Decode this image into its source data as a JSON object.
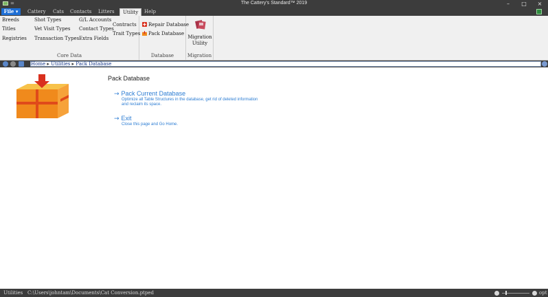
{
  "window": {
    "title": "The Cattery's Standard™ 2019",
    "quick_access": "=",
    "minimize": "–",
    "maximize": "□",
    "close": "×"
  },
  "menu": {
    "file": "File ▾",
    "tabs": [
      "Cattery",
      "Cats",
      "Contacts",
      "Litters",
      "Utility",
      "Help"
    ],
    "active_tab": "Utility"
  },
  "ribbon": {
    "core_data": {
      "caption": "Core Data",
      "col1": [
        "Breeds",
        "Titles",
        "Registries"
      ],
      "col2": [
        "Shot Types",
        "Vet Visit Types",
        "Transaction Types"
      ],
      "col3": [
        "G/L Accounts",
        "Contact Types",
        "Extra Fields"
      ],
      "col4": [
        "Contracts",
        "Trait Types"
      ]
    },
    "database": {
      "caption": "Database",
      "repair": "Repair Database",
      "pack": "Pack Database"
    },
    "migration": {
      "caption": "Migration",
      "button": "Migration Utility"
    }
  },
  "breadcrumb": {
    "items": [
      "Home",
      "Utilities",
      "Pack Database"
    ],
    "separator": "▸"
  },
  "page": {
    "title": "Pack Database",
    "pack_link": "Pack Current Database",
    "pack_desc_1": "Optimize all Table Structures in the database, get rid of deleted information",
    "pack_desc_2": "and reclaim its space.",
    "exit_link": "Exit",
    "exit_desc": "Close this page and Go Home.",
    "arrow": "→"
  },
  "status": {
    "section": "Utilities",
    "path": "C:\\Users\\johntam\\Documents\\Cat Conversion.ptped",
    "right_label": "opt"
  },
  "colors": {
    "accent": "#1e6fd6",
    "link": "#2b7cd3",
    "chrome": "#3c3c3c",
    "box_orange": "#f08a1c",
    "arrow_red": "#d9301e"
  }
}
